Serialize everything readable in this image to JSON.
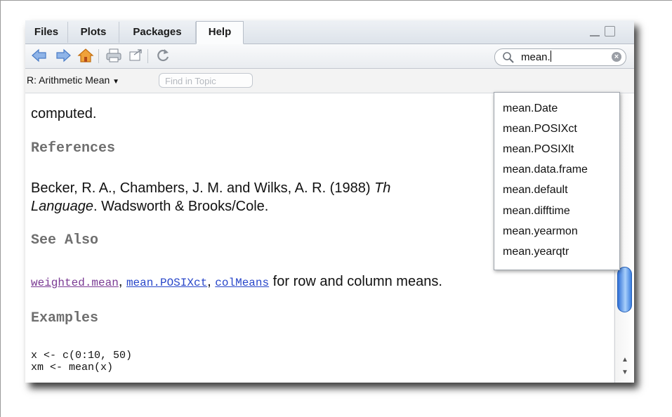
{
  "tabs": [
    {
      "label": "Files"
    },
    {
      "label": "Plots"
    },
    {
      "label": "Packages"
    },
    {
      "label": "Help"
    }
  ],
  "search": {
    "value": "mean."
  },
  "topic": {
    "label": "R: Arithmetic Mean",
    "find_placeholder": "Find in Topic"
  },
  "content": {
    "computed": "computed.",
    "references_header": "References",
    "ref_line1_a": "Becker, R. A., Chambers, J. M. and Wilks, A. R. (1988) ",
    "ref_line1_italic": "Th",
    "ref_line2_italic": "Language",
    "ref_line2_rest": ". Wadsworth & Brooks/Cole.",
    "see_also_header": "See Also",
    "links": [
      "weighted.mean",
      "mean.POSIXct",
      "colMeans"
    ],
    "link_suffix": " for row and column means.",
    "examples_header": "Examples",
    "code_line1": "x <- c(0:10, 50)",
    "code_line2": "xm <- mean(x)"
  },
  "dropdown": {
    "items": [
      "mean.Date",
      "mean.POSIXct",
      "mean.POSIXlt",
      "mean.data.frame",
      "mean.default",
      "mean.difftime",
      "mean.yearmon",
      "mean.yearqtr"
    ]
  },
  "icons": [
    "back-arrow-icon",
    "forward-arrow-icon",
    "home-icon",
    "print-icon",
    "new-window-icon",
    "refresh-icon",
    "search-icon",
    "clear-search-icon"
  ],
  "colors": {
    "link_visited": "#7a3a93",
    "link": "#2846c9",
    "header_gray": "#6f6f6f",
    "home_orange": "#e58a18",
    "arrow_blue": "#5a8fd8"
  }
}
